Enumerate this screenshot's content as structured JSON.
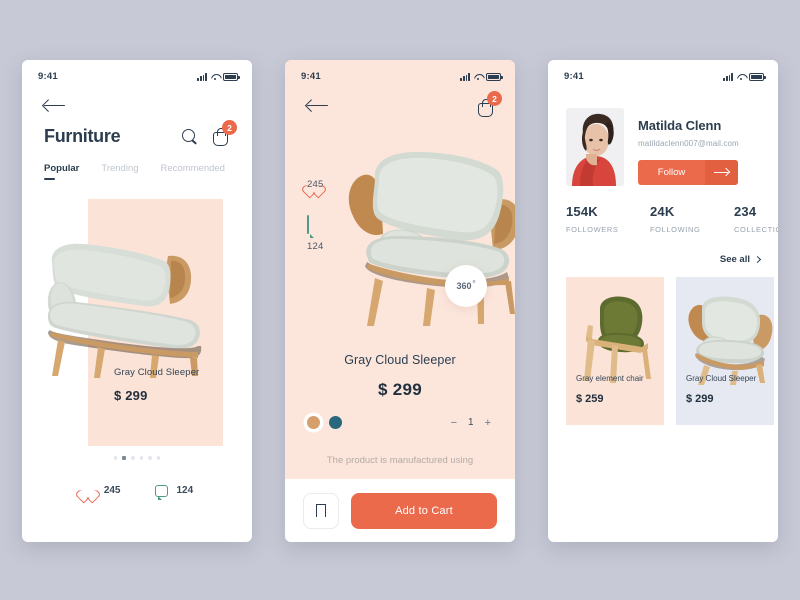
{
  "background_color": "#c7c9d6",
  "accent_color": "#ec6a4c",
  "screen1": {
    "status": {
      "time": "9:41",
      "icons": [
        "signal-icon",
        "wifi-icon",
        "battery-icon"
      ]
    },
    "back_icon": "back-arrow-icon",
    "title": "Furniture",
    "search_icon": "search-icon",
    "bag_icon": "shopping-bag-icon",
    "bag_badge": "2",
    "tabs": [
      {
        "label": "Popular",
        "active": true
      },
      {
        "label": "Trending",
        "active": false
      },
      {
        "label": "Recommended",
        "active": false
      }
    ],
    "card": {
      "name": "Gray  Cloud Sleeper",
      "price": "$ 299",
      "bg_color": "#fce3d7"
    },
    "carousel": {
      "count": 6,
      "active_index": 1
    },
    "stats": {
      "likes_icon": "heart-icon",
      "likes": "245",
      "comments_icon": "comment-icon",
      "comments": "124"
    }
  },
  "screen2": {
    "status": {
      "time": "9:41"
    },
    "back_icon": "back-arrow-icon",
    "bag_icon": "shopping-bag-icon",
    "bag_badge": "2",
    "background_color": "#fce6dc",
    "side": {
      "likes_icon": "heart-icon",
      "likes": "245",
      "comments_icon": "comment-icon",
      "comments": "124"
    },
    "rotate_badge": {
      "label": "360",
      "sup": "o"
    },
    "product": {
      "name": "Gray  Cloud Sleeper",
      "price": "$ 299"
    },
    "colors": [
      {
        "name": "tan",
        "hex": "#d6a06c",
        "selected": true
      },
      {
        "name": "teal",
        "hex": "#27687c",
        "selected": false
      }
    ],
    "quantity": {
      "minus": "−",
      "value": "1",
      "plus": "+"
    },
    "description": "The product is manufactured using",
    "bookmark_icon": "bookmark-icon",
    "add_to_cart_label": "Add to Cart"
  },
  "screen3": {
    "status": {
      "time": "9:41"
    },
    "profile": {
      "avatar": "user-avatar",
      "name": "Matilda Clenn",
      "email": "matildaclenn007@mail.com",
      "follow_label": "Follow",
      "follow_arrow_icon": "arrow-right-icon"
    },
    "stats": [
      {
        "value": "154K",
        "label": "FOLLOWERS"
      },
      {
        "value": "24K",
        "label": "FOLLOWING"
      },
      {
        "value": "234",
        "label": "COLLECTION"
      }
    ],
    "see_all_label": "See all",
    "see_all_icon": "chevron-right-icon",
    "products": [
      {
        "name": "Gray element chair",
        "price": "$ 259",
        "bg_color": "#fce3d7"
      },
      {
        "name": "Gray  Cloud Sleeper",
        "price": "$ 299",
        "bg_color": "#e7e9f2"
      }
    ]
  }
}
